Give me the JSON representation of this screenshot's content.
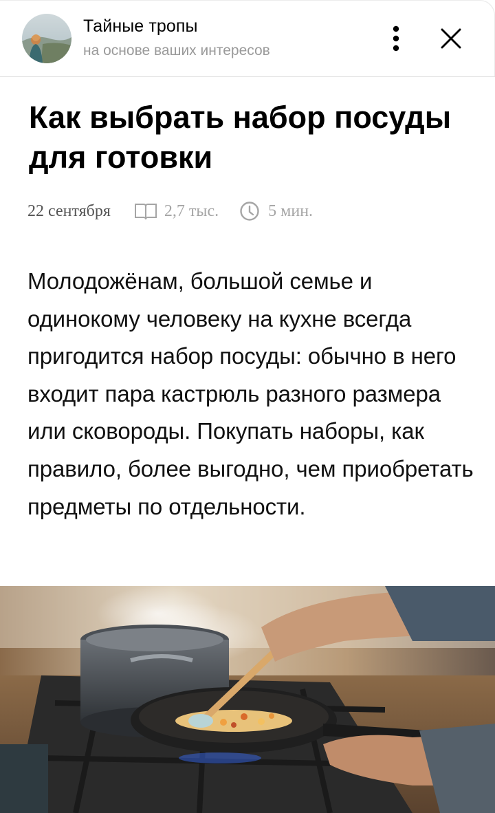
{
  "header": {
    "channel_name": "Тайные тропы",
    "channel_subtitle": "на основе ваших интересов",
    "more_icon": "more-vertical-icon",
    "close_icon": "close-icon"
  },
  "article": {
    "title": "Как выбрать набор посуды для готовки",
    "date": "22 сентября",
    "views": "2,7 тыс.",
    "read_time": "5 мин.",
    "body": "Молодожёнам, большой семье и одинокому человеку на кухне всегда пригодится набор посуды: обычно в него входит пара кастрюль разного размера или сковороды. Покупать наборы, как правило, более выгодно, чем приобретать предметы по отдельности."
  },
  "colors": {
    "subtitle_gray": "#9a9a9a",
    "meta_gray": "#a5a5a5",
    "divider": "#e2e2e2"
  }
}
